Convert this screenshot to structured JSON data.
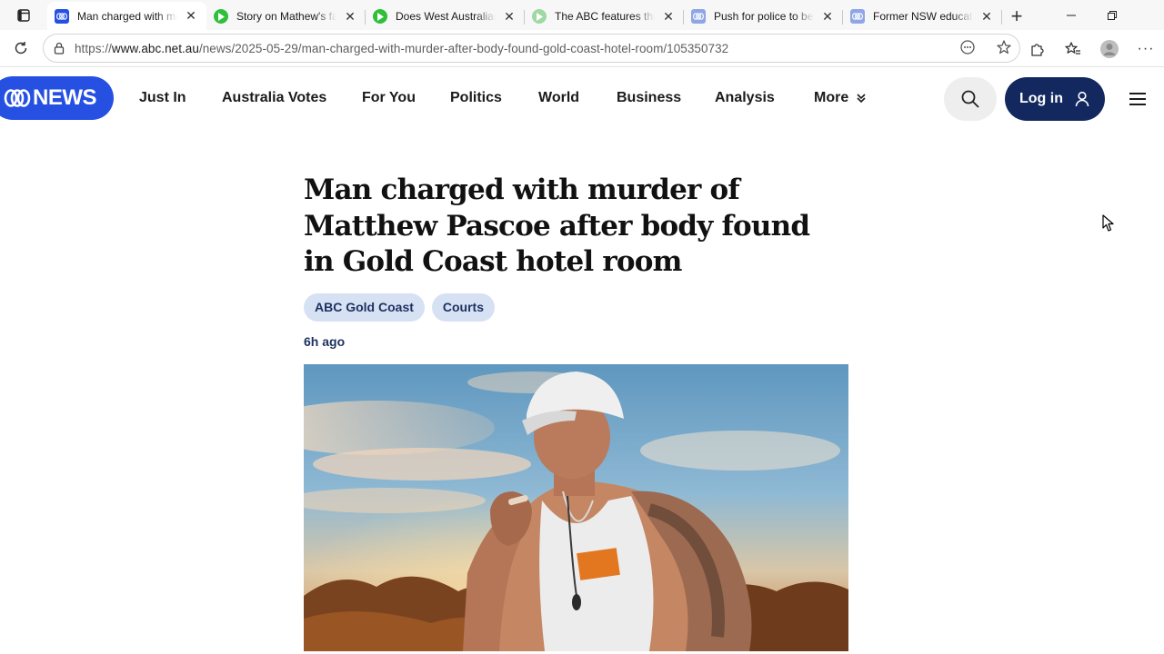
{
  "browser": {
    "tabs": [
      {
        "title": "Man charged with murder",
        "favicon": "abc-icon",
        "active": true
      },
      {
        "title": "Story on Mathew's father",
        "favicon": "play-icon",
        "active": false
      },
      {
        "title": "Does West Australian",
        "favicon": "play-icon",
        "active": false
      },
      {
        "title": "The ABC features third",
        "favicon": "play-icon",
        "active": false
      },
      {
        "title": "Push for police to be",
        "favicon": "abc-icon",
        "active": false
      },
      {
        "title": "Former NSW education",
        "favicon": "abc-icon",
        "active": false
      }
    ],
    "url_prefix": "https://",
    "url_host": "www.abc.net.au",
    "url_path": "/news/2025-05-29/man-charged-with-murder-after-body-found-gold-coast-hotel-room/105350732"
  },
  "site": {
    "logo_text": "NEWS",
    "nav": [
      {
        "label": "Just In"
      },
      {
        "label": "Australia Votes"
      },
      {
        "label": "For You"
      },
      {
        "label": "Politics"
      },
      {
        "label": "World"
      },
      {
        "label": "Business"
      },
      {
        "label": "Analysis"
      },
      {
        "label": "More"
      }
    ],
    "login_label": "Log in"
  },
  "article": {
    "headline": "Man charged with murder of Matthew Pascoe after body found in Gold Coast hotel room",
    "tags": [
      {
        "label": "ABC Gold Coast"
      },
      {
        "label": "Courts"
      }
    ],
    "time": "6h ago"
  },
  "colors": {
    "abc_blue": "#2550e2",
    "login_navy": "#12285e",
    "tag_bg": "#d7e1f4",
    "tag_text": "#1d315f"
  }
}
